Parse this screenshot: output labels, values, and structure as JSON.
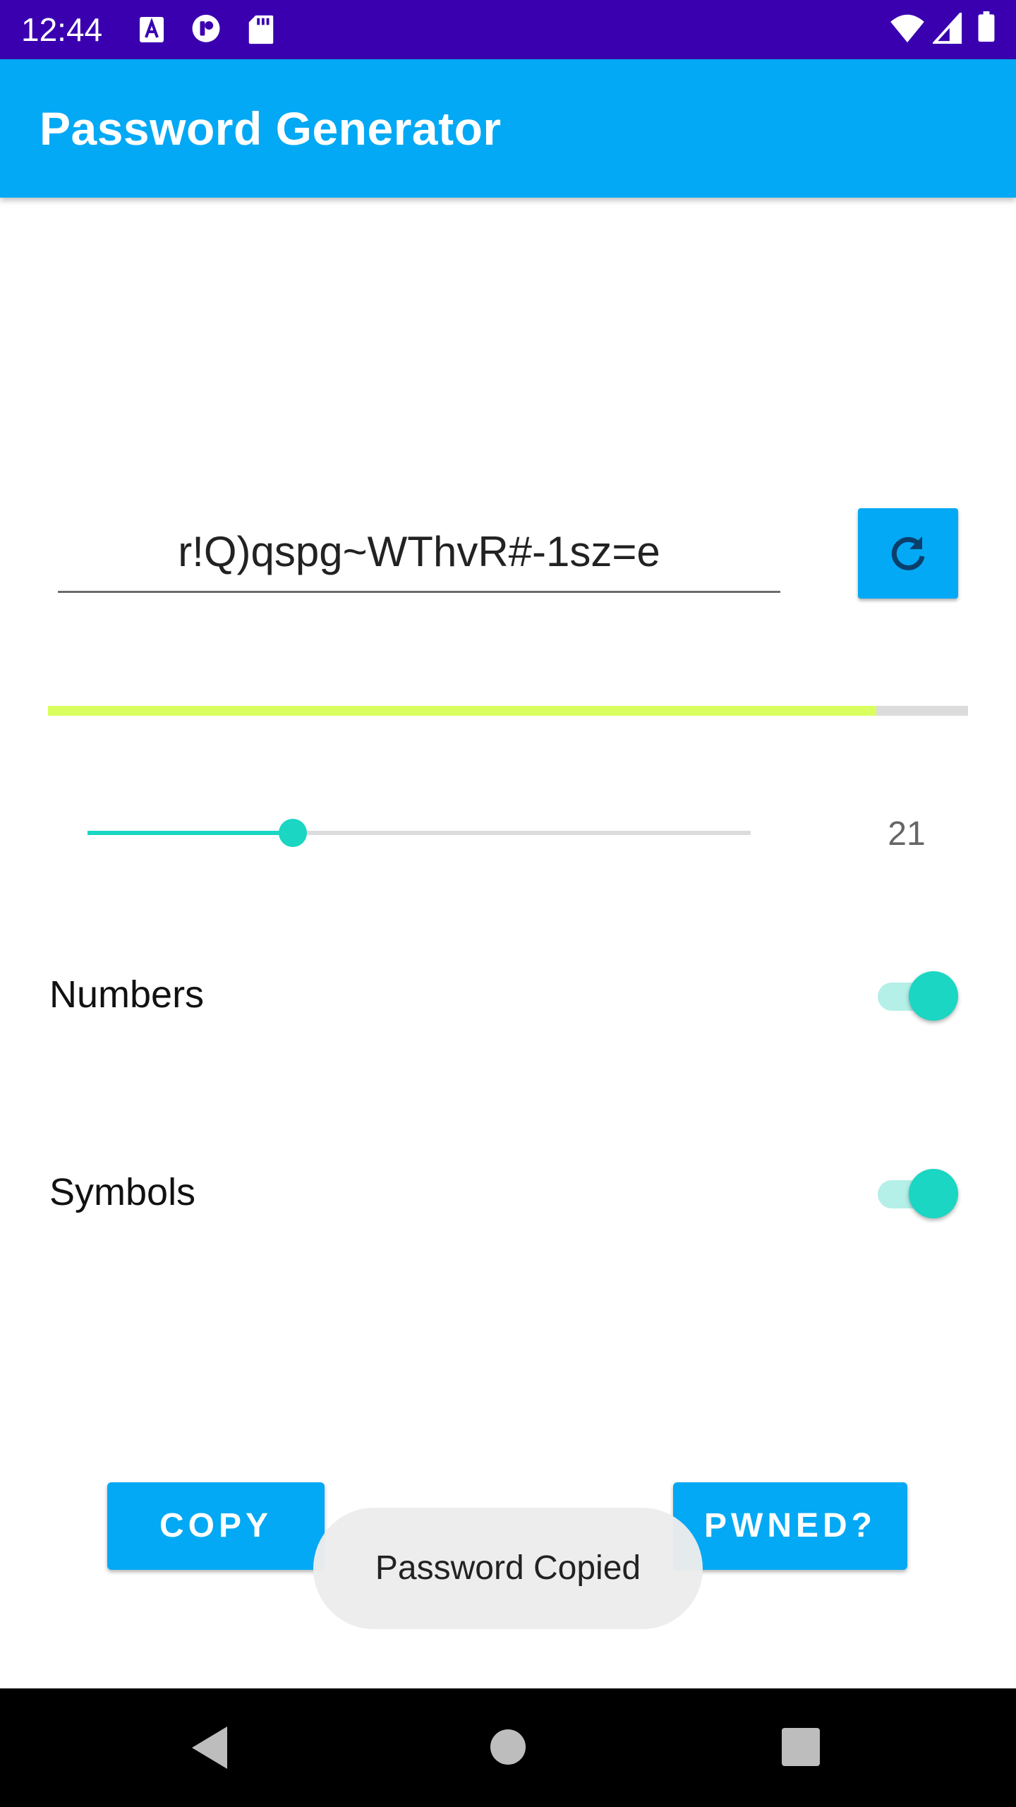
{
  "status_bar": {
    "time": "12:44",
    "left_icons": [
      "a-notification-icon",
      "record-icon",
      "sd-card-icon"
    ],
    "right_icons": [
      "wifi-icon",
      "cellular-signal-icon",
      "battery-icon"
    ]
  },
  "app_bar": {
    "title": "Password Generator"
  },
  "password": {
    "value": "r!Q)qspg~WThvR#-1sz=e",
    "refresh_icon": "refresh-icon"
  },
  "strength": {
    "fraction": 0.9,
    "fill_color": "#d8ff5e",
    "track_color": "#dcdcdc"
  },
  "length": {
    "value": "21",
    "slider_fraction": 0.31,
    "accent_color": "#1ad6c2"
  },
  "options": {
    "numbers": {
      "label": "Numbers",
      "checked": true
    },
    "symbols": {
      "label": "Symbols",
      "checked": true
    }
  },
  "actions": {
    "copy_label": "COPY",
    "pwned_label": "PWNED?"
  },
  "toast": {
    "message": "Password Copied"
  },
  "nav_bar": {
    "icons": [
      "back-icon",
      "home-icon",
      "recents-icon"
    ]
  },
  "colors": {
    "primary": "#03a9f4",
    "status_bar": "#3a00b0",
    "accent": "#1ad6c2"
  }
}
